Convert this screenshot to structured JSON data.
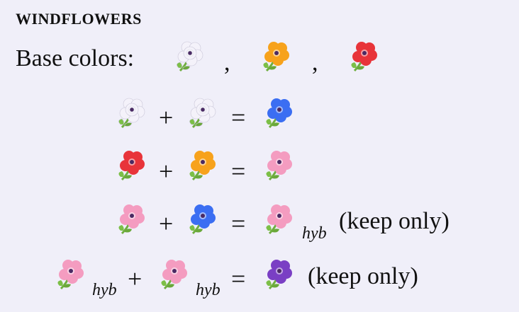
{
  "title": "WINDFLOWERS",
  "base_label": "Base colors:",
  "separator": ",",
  "plus": "+",
  "equals": "=",
  "hyb": "hyb",
  "keep_only": "(keep only)",
  "colors": {
    "white": "#f4f2fa",
    "orange": "#f7a21c",
    "red": "#e8343a",
    "blue": "#3b6ef2",
    "pink": "#f49cc0",
    "purple": "#7a3fc4",
    "center": "#4a2a63",
    "stem": "#6fae3f"
  },
  "base_flowers": [
    "white-windflower",
    "orange-windflower",
    "red-windflower"
  ],
  "recipes": [
    {
      "a": "white-windflower",
      "b": "white-windflower",
      "result": "blue-windflower"
    },
    {
      "a": "red-windflower",
      "b": "orange-windflower",
      "result": "pink-windflower"
    },
    {
      "a": "pink-windflower",
      "b": "blue-windflower",
      "result": "pink-windflower-hyb",
      "note": "(keep only)"
    },
    {
      "a": "pink-windflower-hyb",
      "b": "pink-windflower-hyb",
      "result": "purple-windflower",
      "note": "(keep only)"
    }
  ]
}
